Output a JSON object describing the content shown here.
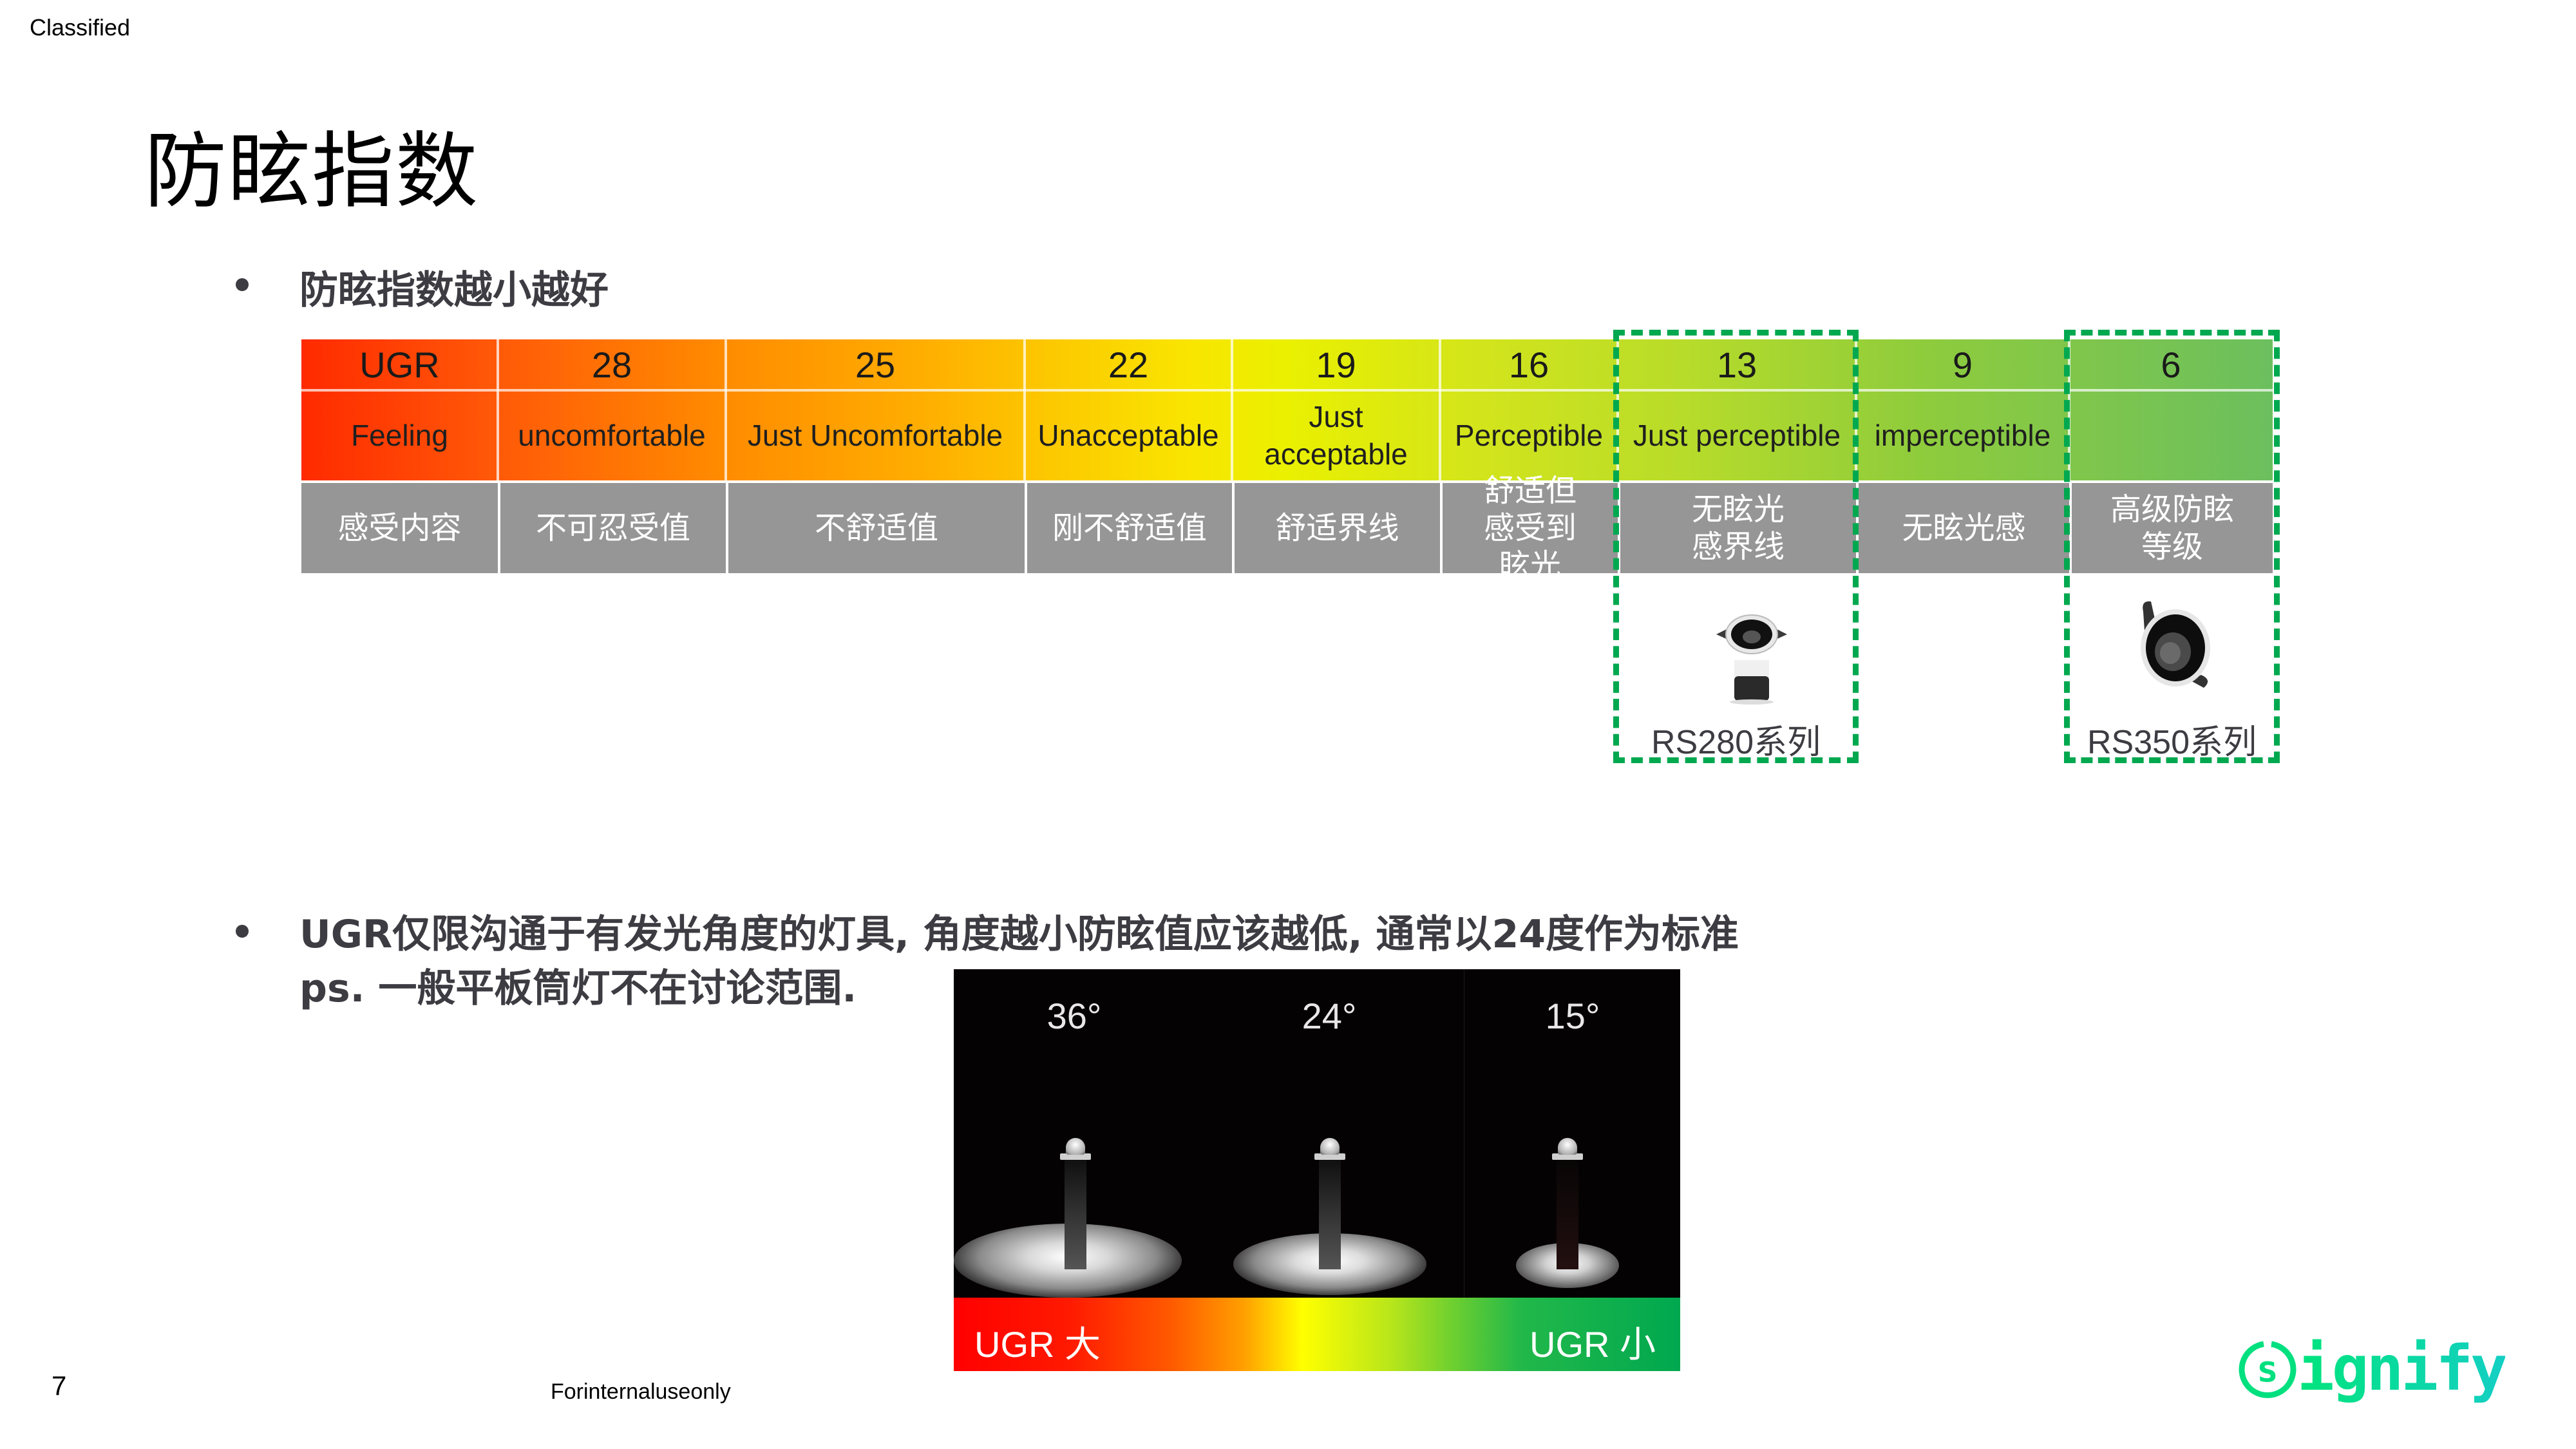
{
  "header": {
    "classification": "Classified",
    "title": "防眩指数"
  },
  "bullets": [
    {
      "text": "防眩指数越小越好"
    },
    {
      "line1": "UGR仅限沟通于有发光角度的灯具, 角度越小防眩值应该越低, 通常以24度作为标准",
      "line2": "ps. 一般平板筒灯不在讨论范围."
    }
  ],
  "ugr_table": {
    "row_headers": {
      "ugr": "UGR",
      "feeling": "Feeling",
      "cn": "感受内容"
    },
    "columns": [
      {
        "ugr": "28",
        "feeling": "uncomfortable",
        "cn": "不可忍受值"
      },
      {
        "ugr": "25",
        "feeling": "Just Uncomfortable",
        "cn": "不舒适值"
      },
      {
        "ugr": "22",
        "feeling": "Unacceptable",
        "cn": "刚不舒适值"
      },
      {
        "ugr": "19",
        "feeling": "Just acceptable",
        "cn": "舒适界线"
      },
      {
        "ugr": "16",
        "feeling": "Perceptible",
        "cn": "舒适但感受到眩光"
      },
      {
        "ugr": "13",
        "feeling": "Just perceptible",
        "cn": "无眩光感界线"
      },
      {
        "ugr": "9",
        "feeling": "imperceptible",
        "cn": "无眩光感"
      },
      {
        "ugr": "6",
        "feeling": "",
        "cn": "高级防眩等级"
      }
    ],
    "colors": {
      "start": "#ff2a00",
      "mid": "#f9e500",
      "end": "#6cbf5e",
      "gray_cell": "#969696"
    }
  },
  "highlights": [
    {
      "ugr": "13",
      "product": "RS280系列",
      "icon": "downlight-rs280-icon"
    },
    {
      "ugr": "6",
      "product": "RS350系列",
      "icon": "downlight-rs350-icon"
    }
  ],
  "highlight_color": "#00a84f",
  "beam_photo": {
    "angles": [
      "36°",
      "24°",
      "15°"
    ],
    "scale_left": "UGR 大",
    "scale_right": "UGR 小"
  },
  "footer": {
    "page_number": "7",
    "notice": "Forinternaluseonly",
    "logo": "signify"
  },
  "brand_color": "#00e07f"
}
